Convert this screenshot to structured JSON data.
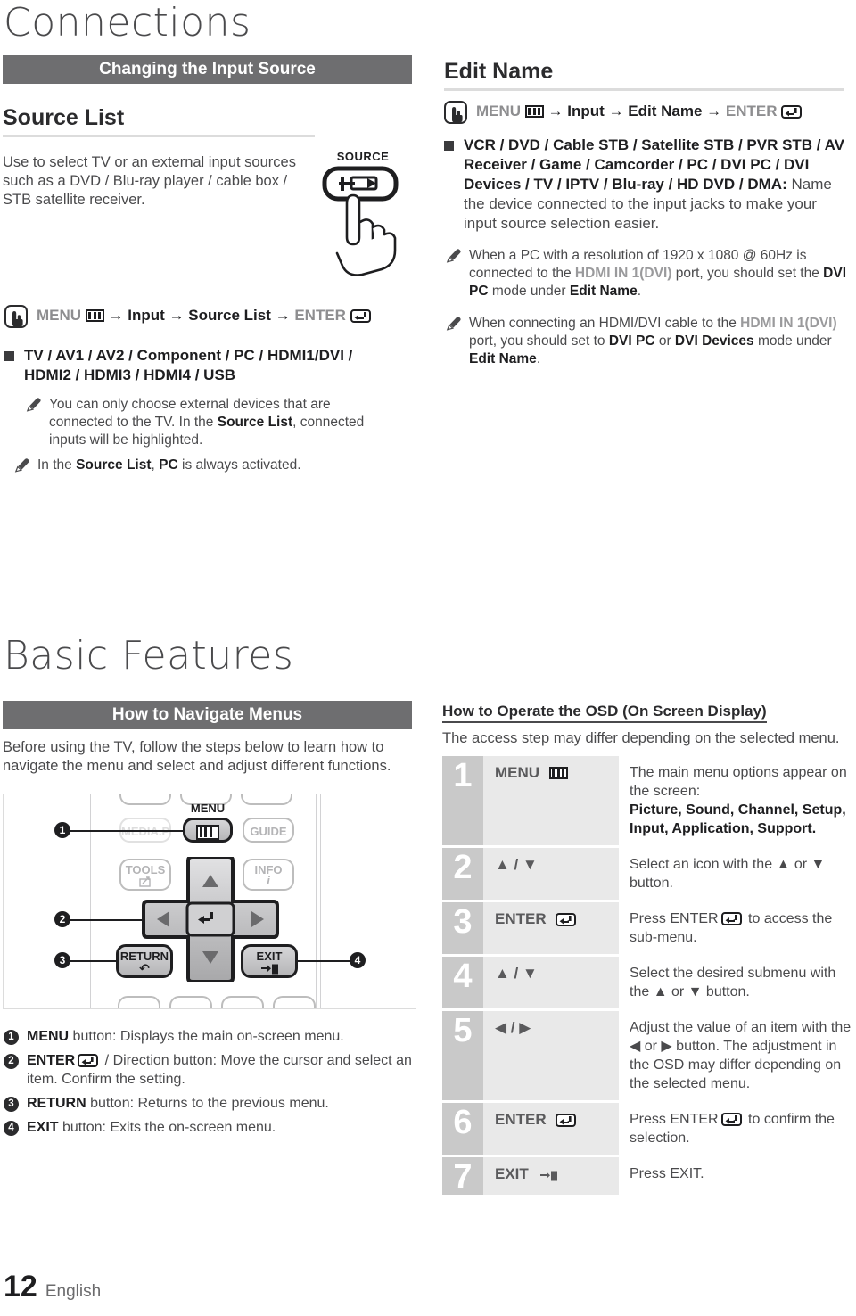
{
  "chapters": {
    "connections": "Connections",
    "basic_features": "Basic Features"
  },
  "section_bars": {
    "changing_input_source": "Changing the Input Source",
    "how_to_navigate_menus": "How to Navigate Menus"
  },
  "source_list": {
    "heading": "Source List",
    "description": "Use to select TV or an external input sources such as a DVD / Blu-ray player / cable box / STB satellite receiver.",
    "source_button_label": "SOURCE",
    "path": {
      "menu": "MENU",
      "arrow": "→",
      "step1": "Input",
      "step2": "Source List",
      "enter": "ENTER"
    },
    "options": "TV / AV1 /  AV2 / Component / PC / HDMI1/DVI / HDMI2 / HDMI3 / HDMI4 / USB",
    "notes": [
      {
        "p1": "You can only choose external devices that are connected to the TV. In the ",
        "b1": "Source List",
        "p2": ", connected inputs will be highlighted."
      },
      {
        "p1": "In the ",
        "b1": "Source List",
        "p2": ", ",
        "b2": "PC",
        "p3": " is always activated."
      }
    ]
  },
  "edit_name": {
    "heading": "Edit Name",
    "path": {
      "menu": "MENU",
      "arrow": "→",
      "step1": "Input",
      "step2": "Edit Name",
      "enter": "ENTER"
    },
    "options_bold": "VCR / DVD / Cable STB / Satellite STB / PVR STB / AV Receiver / Game / Camcorder / PC / DVI PC / DVI Devices / TV / IPTV / Blu-ray / HD DVD / DMA:",
    "options_rest": " Name the device connected to the input jacks to make your input source selection easier.",
    "notes": [
      {
        "p1": "When a PC with a resolution of 1920 x 1080 @ 60Hz is connected to the ",
        "g1": "HDMI IN 1(DVI)",
        "p2": " port, you should set the ",
        "b1": "DVI PC",
        "p3": " mode under ",
        "b2": "Edit Name",
        "p4": "."
      },
      {
        "p1": "When connecting an HDMI/DVI cable to the ",
        "g1": "HDMI IN 1(DVI)",
        "p2": " port, you should set to ",
        "b1": "DVI PC",
        "p3": " or ",
        "b2": "DVI Devices",
        "p4": " mode under ",
        "b3": "Edit Name",
        "p5": "."
      }
    ]
  },
  "navigate_menus": {
    "intro": "Before using the TV, follow the steps below to learn how to navigate the menu and select and adjust different functions.",
    "remote_buttons": {
      "menu_label": "MENU",
      "guide": "GUIDE",
      "tools": "TOOLS",
      "info": "INFO",
      "media_p": "MEDIA.P",
      "return": "RETURN",
      "exit": "EXIT"
    },
    "callouts": [
      "1",
      "2",
      "3",
      "4"
    ],
    "legend": [
      {
        "num": "1",
        "bold": "MENU",
        "text": " button: Displays the main on-screen menu."
      },
      {
        "num": "2",
        "bold": "ENTER",
        "text": " / Direction button: Move the cursor and select an item. Confirm the setting."
      },
      {
        "num": "3",
        "bold": "RETURN",
        "text": " button: Returns to the previous menu."
      },
      {
        "num": "4",
        "bold": "EXIT",
        "text": " button: Exits the on-screen menu."
      }
    ]
  },
  "osd": {
    "heading": "How to Operate the OSD (On Screen Display)",
    "subtext": "The access step may differ depending on the selected menu.",
    "rows": [
      {
        "num": "1",
        "button": "MENU",
        "button_icon": "menu-icon",
        "desc_pre": "The main menu options appear on the screen:",
        "desc_bold": "Picture, Sound, Channel, Setup, Input, Application, Support.",
        "desc_post": ""
      },
      {
        "num": "2",
        "button": "▲ / ▼",
        "button_icon": "",
        "desc_pre": "Select an icon with the ▲ or ▼ button.",
        "desc_bold": "",
        "desc_post": ""
      },
      {
        "num": "3",
        "button": "ENTER",
        "button_icon": "enter-icon",
        "desc_pre": "Press ENTER",
        "desc_bold": "",
        "desc_post": " to access the sub-menu."
      },
      {
        "num": "4",
        "button": "▲ / ▼",
        "button_icon": "",
        "desc_pre": "Select the desired submenu with the ▲ or ▼ button.",
        "desc_bold": "",
        "desc_post": ""
      },
      {
        "num": "5",
        "button": "◀ / ▶",
        "button_icon": "",
        "desc_pre": "Adjust the value of an item with the ◀ or ▶ button. The adjustment in the OSD may differ depending on the selected menu.",
        "desc_bold": "",
        "desc_post": ""
      },
      {
        "num": "6",
        "button": "ENTER",
        "button_icon": "enter-icon",
        "desc_pre": "Press ENTER",
        "desc_bold": "",
        "desc_post": " to confirm the selection."
      },
      {
        "num": "7",
        "button": "EXIT",
        "button_icon": "exit-icon",
        "desc_pre": "Press EXIT.",
        "desc_bold": "",
        "desc_post": ""
      }
    ]
  },
  "footer": {
    "page_number": "12",
    "language": "English"
  },
  "colors": {
    "bar_grey": "#6e6e70",
    "num_col_grey": "#c9c9c9",
    "btn_col_grey": "#e9e9e9",
    "text": "#4a4a4c"
  }
}
